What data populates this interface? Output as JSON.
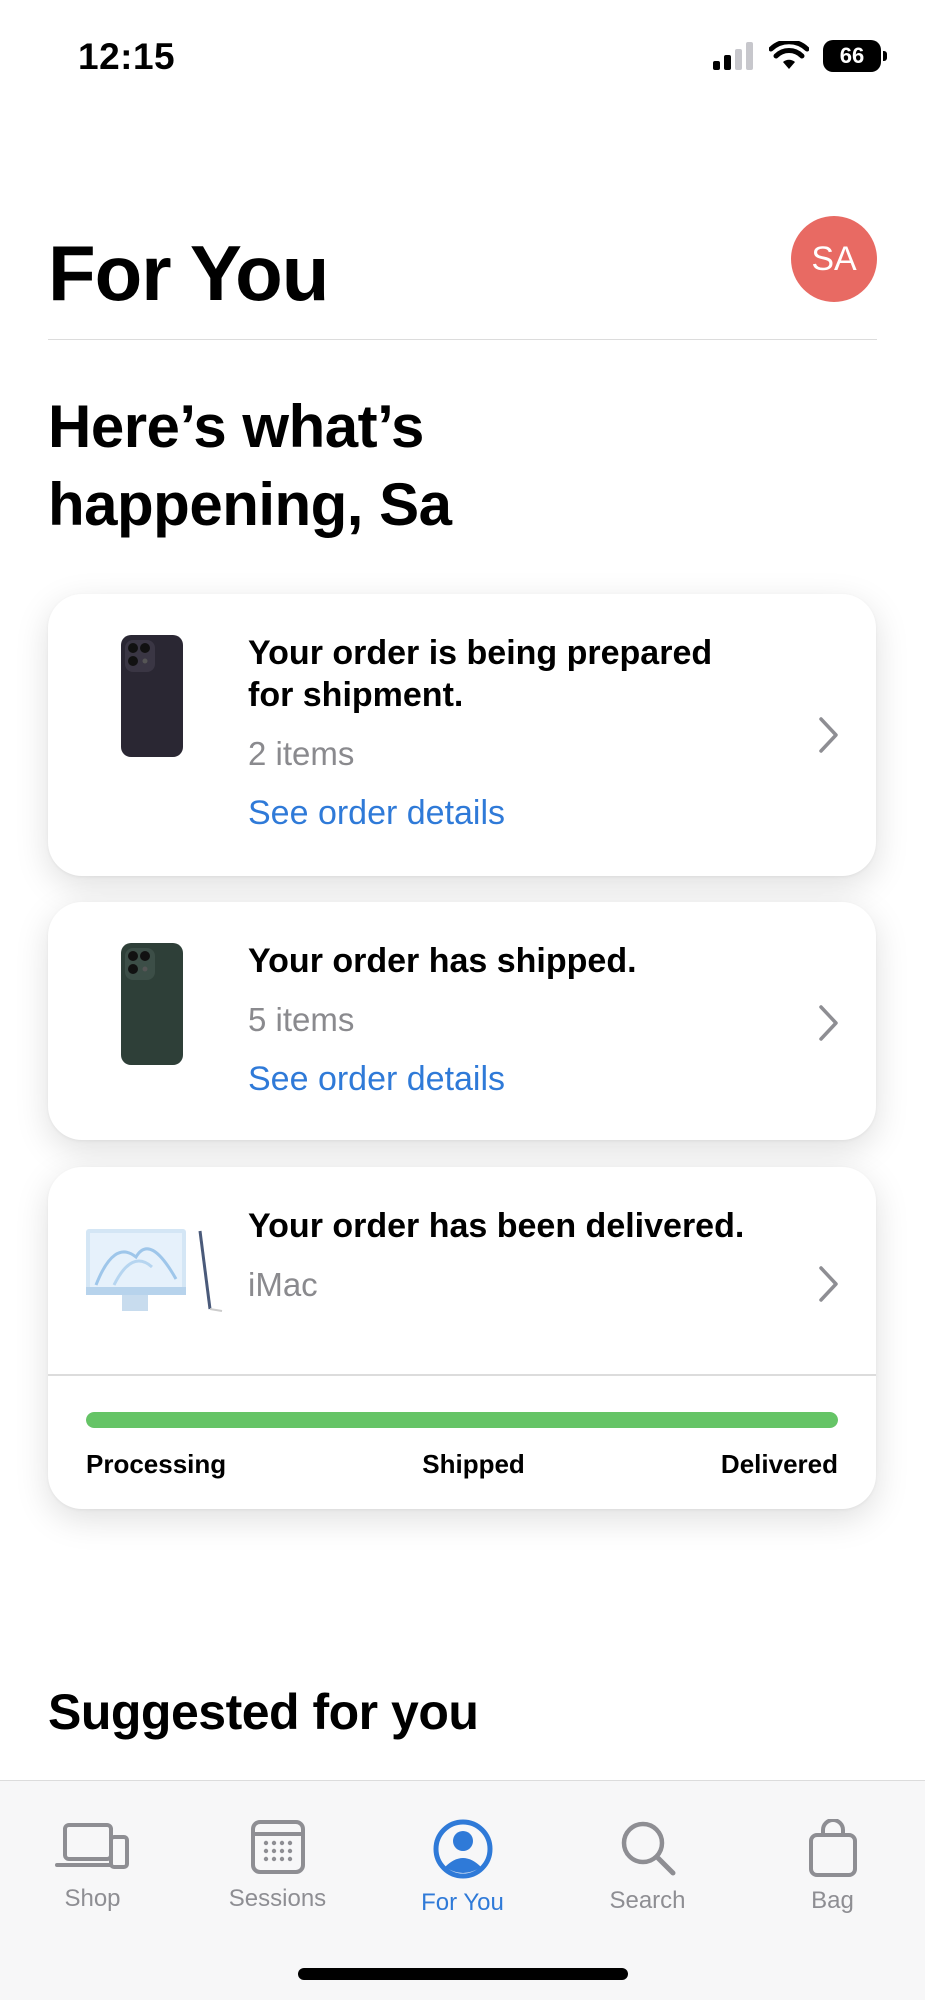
{
  "status_bar": {
    "time": "12:15",
    "battery": "66"
  },
  "header": {
    "title": "For You",
    "avatar_initials": "SA"
  },
  "greeting": "Here’s what’s\nhappening, Sa",
  "orders": [
    {
      "title": "Your order is being prepared for shipment.",
      "subtitle": "2 items",
      "link": "See order details",
      "thumb": "iphone-purple"
    },
    {
      "title": "Your order has shipped.",
      "subtitle": "5 items",
      "link": "See order details",
      "thumb": "iphone-green"
    },
    {
      "title": "Your order has been delivered.",
      "subtitle": "iMac",
      "thumb": "imac-blue",
      "progress": {
        "value": 1.0,
        "labels": [
          "Processing",
          "Shipped",
          "Delivered"
        ]
      }
    }
  ],
  "suggested_title": "Suggested for you",
  "tabs": [
    {
      "label": "Shop",
      "icon": "laptop-phone-icon",
      "active": false
    },
    {
      "label": "Sessions",
      "icon": "calendar-grid-icon",
      "active": false
    },
    {
      "label": "For You",
      "icon": "person-circle-icon",
      "active": true
    },
    {
      "label": "Search",
      "icon": "search-icon",
      "active": false
    },
    {
      "label": "Bag",
      "icon": "bag-icon",
      "active": false
    }
  ],
  "colors": {
    "accent": "#2f7ad8",
    "avatar": "#e86a63",
    "progress": "#65c466",
    "secondary_text": "#8a8a8e"
  }
}
